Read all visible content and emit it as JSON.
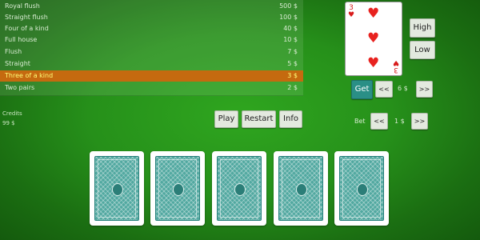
{
  "paytable": [
    {
      "name": "Royal flush",
      "amount": "500 $"
    },
    {
      "name": "Straight flush",
      "amount": "100 $"
    },
    {
      "name": "Four of a kind",
      "amount": "40 $"
    },
    {
      "name": "Full house",
      "amount": "10 $"
    },
    {
      "name": "Flush",
      "amount": "7 $"
    },
    {
      "name": "Straight",
      "amount": "5 $"
    },
    {
      "name": "Three of a kind",
      "amount": "3 $"
    },
    {
      "name": "Two pairs",
      "amount": "2 $"
    }
  ],
  "credits": {
    "label": "Credits",
    "value": "99 $"
  },
  "buttons": {
    "play": "Play",
    "restart": "Restart",
    "info": "Info",
    "high": "High",
    "low": "Low",
    "get": "Get"
  },
  "gamble": {
    "decrease": "<<",
    "value": "6 $",
    "increase": ">>"
  },
  "bet": {
    "label": "Bet",
    "decrease": "<<",
    "value": "1 $",
    "increase": ">>"
  },
  "preview_card": {
    "rank": "3",
    "suit_icon": "heart-icon",
    "suit": "♥"
  },
  "hand": {
    "card_back_icon": "card-back-icon",
    "count": 5
  },
  "colors": {
    "felt": "#26901a",
    "highlight_row": "#c56a0f",
    "highlight_text": "#ffff7a",
    "get_button": "#2a8f86",
    "heart": "#e8221f"
  }
}
